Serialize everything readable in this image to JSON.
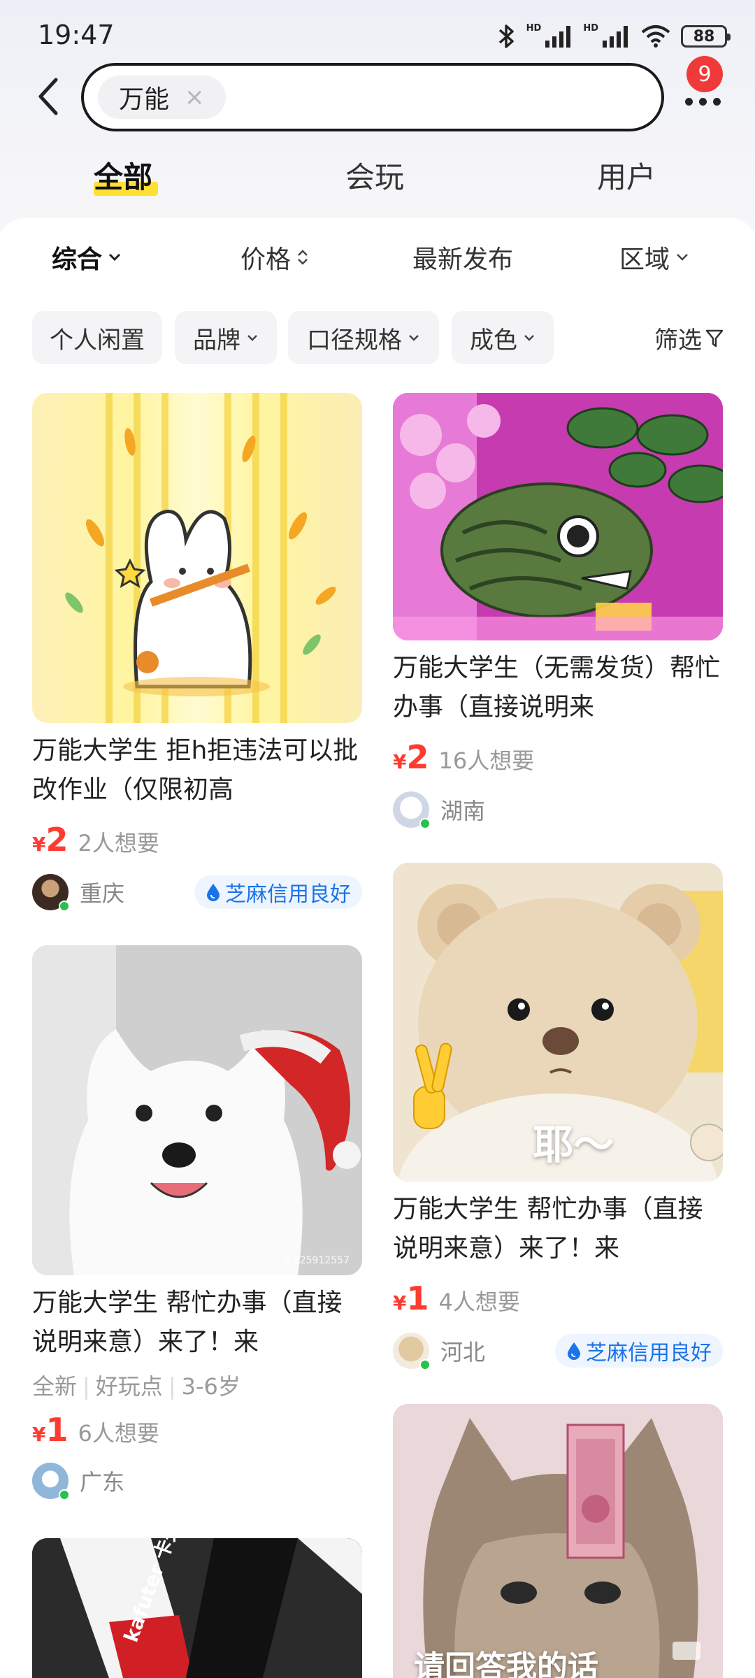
{
  "status_bar": {
    "time": "19:47",
    "battery": "88",
    "hd1": "HD",
    "hd2": "HD"
  },
  "search": {
    "keyword": "万能",
    "clear_glyph": "×",
    "notification_count": "9"
  },
  "tabs": [
    {
      "label": "全部",
      "active": true
    },
    {
      "label": "会玩"
    },
    {
      "label": "用户"
    }
  ],
  "sort": [
    "综合",
    "价格",
    "最新发布",
    "区域"
  ],
  "filters": [
    "个人闲置",
    "品牌",
    "口径规格",
    "成色"
  ],
  "screen_label": "筛选",
  "cards": [
    {
      "title": "万能大学生 拒h拒违法可以批改作业（仅限初高",
      "price_symbol": "¥",
      "price": "2",
      "want": "2人想要",
      "location": "重庆",
      "credit": "芝麻信用良好"
    },
    {
      "title": "万能大学生（无需发货）帮忙办事（直接说明来",
      "price_symbol": "¥",
      "price": "2",
      "want": "16人想要",
      "location": "湖南"
    },
    {
      "title": "万能大学生 帮忙办事（直接说明来意）来了！来",
      "tags": [
        "全新",
        "好玩点",
        "3-6岁"
      ],
      "price_symbol": "¥",
      "price": "1",
      "want": "6人想要",
      "location": "广东",
      "image_caption": "小红书 425912557"
    },
    {
      "title": "万能大学生 帮忙办事（直接说明来意）来了！来",
      "price_symbol": "¥",
      "price": "1",
      "want": "4人想要",
      "location": "河北",
      "credit": "芝麻信用良好",
      "image_caption": "耶～"
    },
    {
      "image_caption": "kafuter 卡夫特 得力 强力胶"
    },
    {
      "image_caption": "请回答我的话"
    }
  ],
  "colors": {
    "accent_yellow": "#ffe033",
    "price_red": "#ff3b30",
    "credit_blue": "#1a73e8",
    "badge_red": "#f03a3a"
  }
}
